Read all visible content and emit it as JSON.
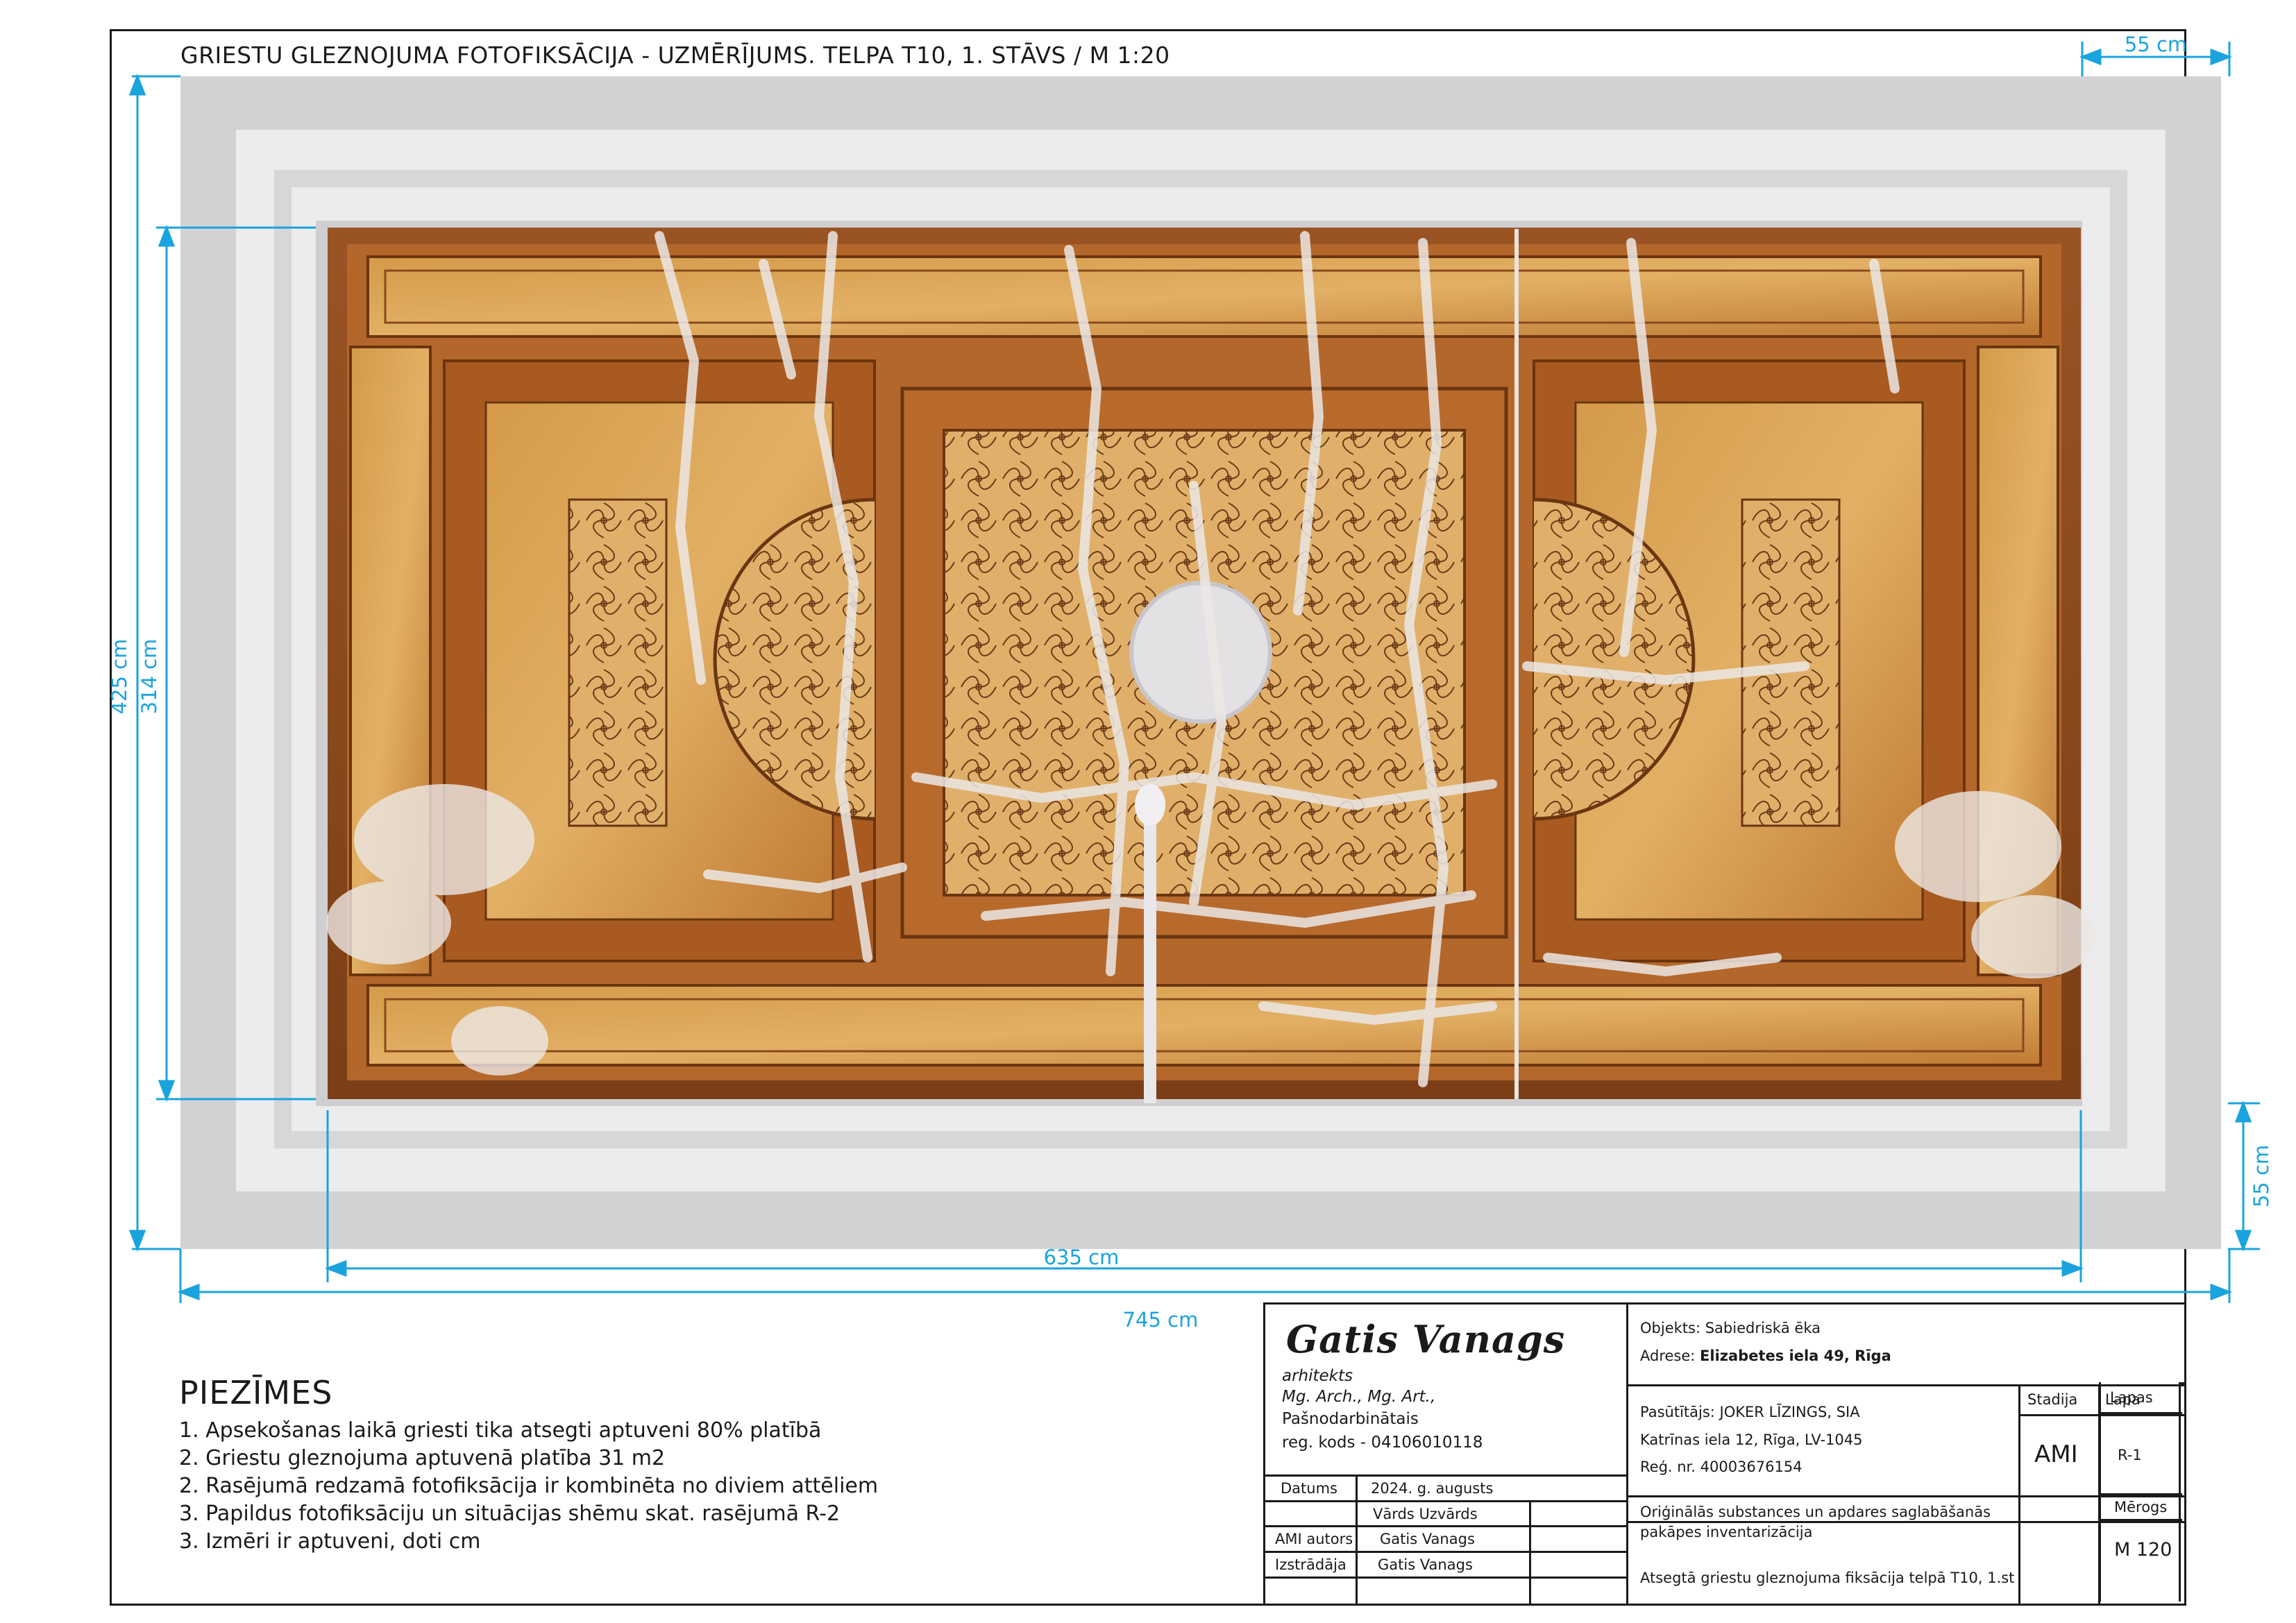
{
  "drawing": {
    "title": "GRIESTU GLEZNOJUMA FOTOFIKSĀCIJA - UZMĒRĪJUMS. TELPA T10, 1. STĀVS   /  M 1:20",
    "dimensions": {
      "border_width": "55 cm",
      "border_height": "55 cm",
      "inner_width": "635 cm",
      "outer_width": "745 cm",
      "inner_height": "314 cm",
      "outer_height": "425 cm"
    },
    "colors": {
      "dimension_line": "#1aa3dd",
      "frame_outer": "#d2d2d4",
      "frame_light": "#ececee",
      "painting_base": "#c98a3c",
      "painting_dark": "#8a4a1c",
      "damage": "#e6e2e0"
    }
  },
  "notes": {
    "heading": "PIEZĪMES",
    "items": [
      "1. Apsekošanas laikā griesti tika atsegti aptuveni 80% platībā",
      "2. Griestu gleznojuma aptuvenā platība 31 m2",
      "2. Rasējumā redzamā fotofiksācija ir kombinēta no diviem attēliem",
      "3. Papildus fotofiksāciju un situācijas shēmu skat. rasējumā R-2",
      "3. Izmēri ir aptuveni, doti cm"
    ]
  },
  "title_block": {
    "architect": {
      "name": "Gatis Vanags",
      "role": "arhitekts",
      "degrees": "Mg. Arch., Mg. Art.,",
      "status": "Pašnodarbinātais",
      "reg_code": "reg. kods - 04106010118"
    },
    "date_label": "Datums",
    "date_value": "2024. g. augusts",
    "name_header": "Vārds  Uzvārds",
    "ami_author_label": "AMI autors",
    "ami_author_value": "Gatis Vanags",
    "prepared_label": "Izstrādāja",
    "prepared_value": "Gatis Vanags",
    "object": "Objekts: Sabiedriskā ēka",
    "address_label": "Adrese: ",
    "address_value": "Elizabetes iela 49, Rīga",
    "client": "Pasūtītājs: JOKER LĪZINGS, SIA",
    "client_address": "Katrīnas iela 12, Rīga, LV-1045",
    "client_reg": "Reģ. nr. 40003676154",
    "stage_label": "Stadija",
    "stage_value": "AMI",
    "sheet_label": "Lapa",
    "sheet_value": "R-1",
    "sheets_label": "Lapas",
    "sheets_value": "",
    "scale_label": "Mērogs",
    "scale_value": "M 120",
    "project_desc_line1": "Oriģinālās substances un apdares saglabāšanās",
    "project_desc_line2": "pakāpes inventarizācija",
    "drawing_name": "Atsegtā griestu gleznojuma fiksācija telpā T10, 1.st"
  }
}
